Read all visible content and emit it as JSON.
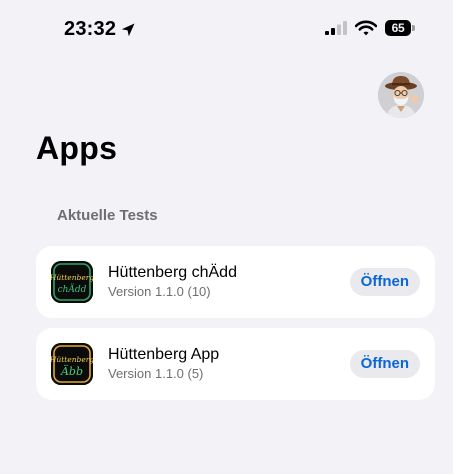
{
  "status_bar": {
    "time": "23:32",
    "battery_level": "65",
    "icons": [
      "location-arrow-icon",
      "signal-icon",
      "wifi-icon",
      "battery-icon"
    ]
  },
  "header": {
    "title": "Apps",
    "avatar_icon": "memoji-avatar-icon"
  },
  "section": {
    "header": "Aktuelle Tests"
  },
  "apps": [
    {
      "name": "Hüttenberg chÄdd",
      "version": "Version 1.1.0 (10)",
      "button_label": "Öffnen",
      "icon_brand": "Hüttenberg",
      "icon_word": "chÄdd",
      "icon_frame_color": "#2ea36a",
      "icon_word_color": "#3ec27f"
    },
    {
      "name": "Hüttenberg App",
      "version": "Version 1.1.0 (5)",
      "button_label": "Öffnen",
      "icon_brand": "Hüttenberg",
      "icon_word": "Äbb",
      "icon_frame_color": "#e3a92b",
      "icon_word_color": "#4dd07a"
    }
  ],
  "colors": {
    "background": "#f2f2f7",
    "card": "#ffffff",
    "accent": "#0a67d6",
    "secondary_text": "#6e6e73",
    "button_bg": "#e9e9ee"
  }
}
